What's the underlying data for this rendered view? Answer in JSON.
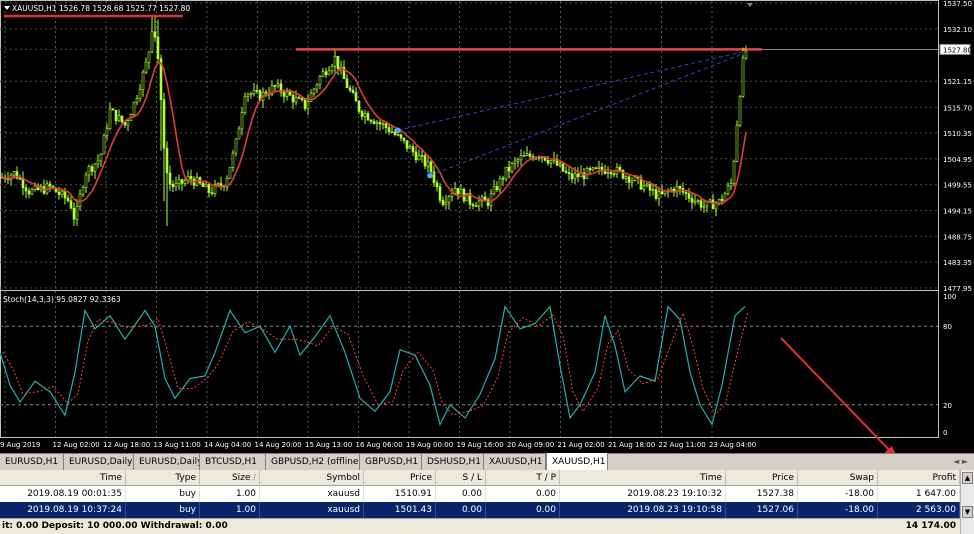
{
  "chart": {
    "title": "XAUUSD,H1  1526.78 1528.68 1525.77 1527.80",
    "price_labels": [
      "1537.50",
      "1532.10",
      "1527.80",
      "1521.15",
      "1515.70",
      "1510.35",
      "1504.95",
      "1499.55",
      "1494.15",
      "1488.75",
      "1483.35",
      "1477.95"
    ],
    "current_price": "1527.80",
    "indicator_title": "Stoch(14,3,3) 95.0827 92.3363",
    "indicator_labels": [
      "100",
      "80",
      "20",
      "0"
    ],
    "time_labels": [
      "9 Aug 2019",
      "12 Aug 02:00",
      "12 Aug 18:00",
      "13 Aug 11:00",
      "14 Aug 04:00",
      "14 Aug 20:00",
      "15 Aug 13:00",
      "16 Aug 06:00",
      "19 Aug 00:00",
      "19 Aug 16:00",
      "20 Aug 09:00",
      "21 Aug 02:00",
      "21 Aug 18:00",
      "22 Aug 11:00",
      "23 Aug 04:00"
    ],
    "colors": {
      "candles": "#adff2f",
      "ma": "#e03c3c",
      "hline": "#e04848",
      "trend": "#3a3acc",
      "stoch_main": "#20b2aa",
      "stoch_signal": "#ff4040",
      "annotation": "#e03030"
    }
  },
  "tabs": [
    "EURUSD,H1",
    "EURUSD,Daily",
    "EURUSD,Daily",
    "BTCUSD,H1",
    "GBPUSD,H2 (offline)",
    "GBPUSD,H1",
    "DSHUSD,H1",
    "XAUUSD,H1",
    "XAUUSD,H1"
  ],
  "tab_arrows": "◄ ►",
  "terminal": {
    "columns": [
      "Time",
      "Type",
      "Size",
      "Symbol",
      "Price",
      "S / L",
      "T / P",
      "Time",
      "Price",
      "Swap",
      "Profit"
    ],
    "size_arrow": "/",
    "rows": [
      [
        "2019.08.19 00:01:35",
        "buy",
        "1.00",
        "xauusd",
        "1510.91",
        "0.00",
        "0.00",
        "2019.08.23 19:10:32",
        "1527.38",
        "-18.00",
        "1 647.00"
      ],
      [
        "2019.08.19 10:37:24",
        "buy",
        "1.00",
        "xauusd",
        "1501.43",
        "0.00",
        "0.00",
        "2019.08.23 19:10:58",
        "1527.06",
        "-18.00",
        "2 563.00"
      ]
    ],
    "footer_left": "it: 0.00  Deposit: 10 000.00  Withdrawal: 0.00",
    "footer_right": "14 174.00"
  }
}
